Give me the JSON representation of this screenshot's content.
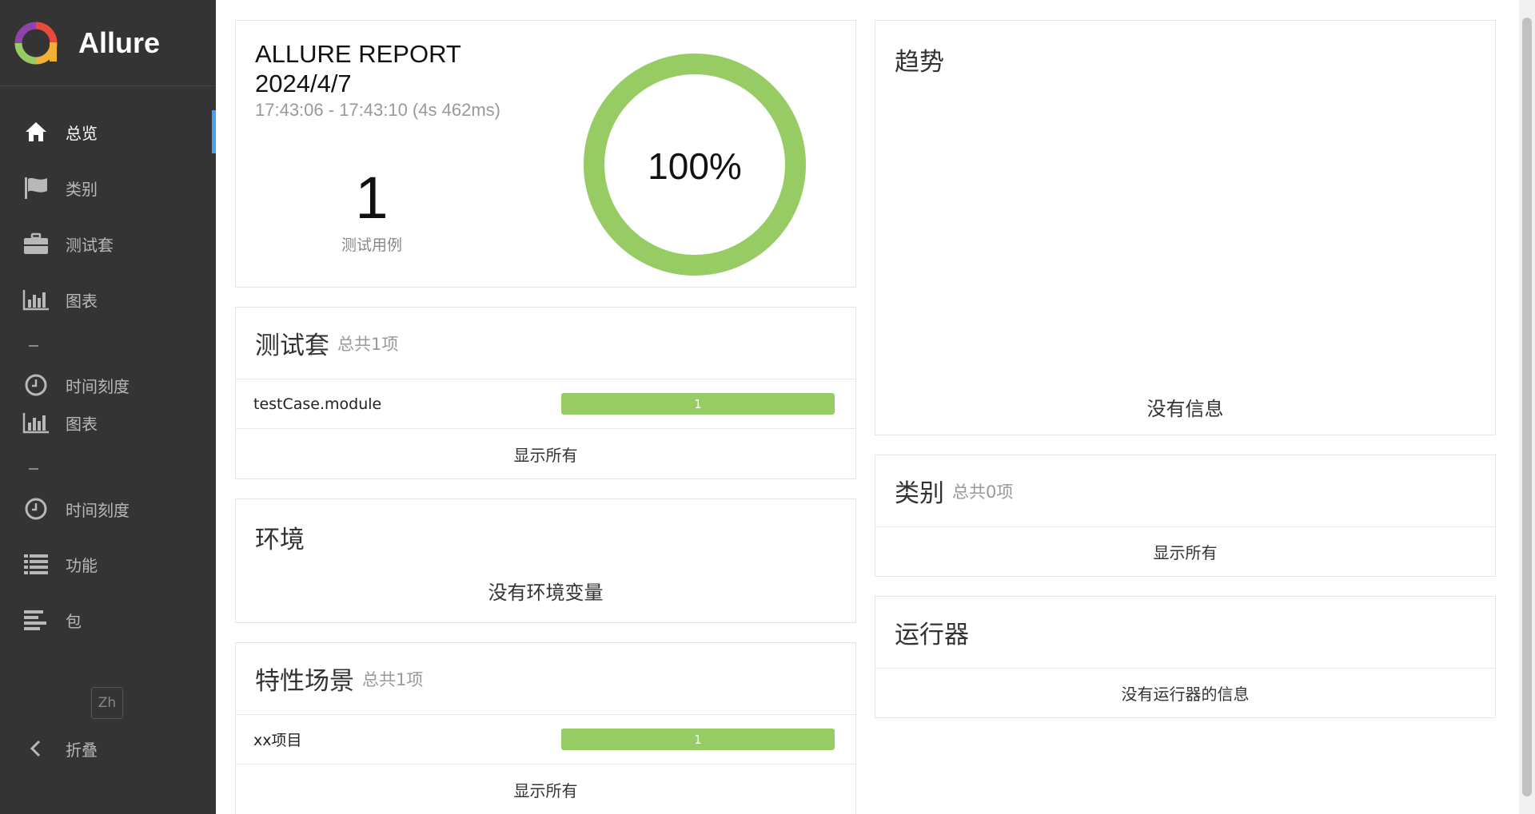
{
  "app": {
    "title": "Allure"
  },
  "sidebar": {
    "items": [
      {
        "label": "总览",
        "icon": "home-icon"
      },
      {
        "label": "类别",
        "icon": "flag-icon"
      },
      {
        "label": "测试套",
        "icon": "briefcase-icon"
      },
      {
        "label": "图表",
        "icon": "bar-chart-icon"
      },
      {
        "label": "时间刻度",
        "icon": "clock-icon"
      },
      {
        "label": "图表",
        "icon": "bar-chart-icon"
      },
      {
        "label": "时间刻度",
        "icon": "clock-icon"
      },
      {
        "label": "功能",
        "icon": "list-icon"
      },
      {
        "label": "包",
        "icon": "align-left-icon"
      }
    ],
    "lang": "Zh",
    "collapse": "折叠"
  },
  "summary": {
    "title": "ALLURE REPORT",
    "date": "2024/4/7",
    "time_range": "17:43:06 - 17:43:10 (4s 462ms)",
    "test_count": "1",
    "test_count_label": "测试用例",
    "pass_percent_label": "100%",
    "pass_fraction": 1.0,
    "ring_color": "#97cc64"
  },
  "suites": {
    "title": "测试套",
    "subtitle": "总共1项",
    "rows": [
      {
        "name": "testCase.module",
        "count": "1"
      }
    ],
    "show_all": "显示所有"
  },
  "environment": {
    "title": "环境",
    "empty": "没有环境变量"
  },
  "features": {
    "title": "特性场景",
    "subtitle": "总共1项",
    "rows": [
      {
        "name": "xx项目",
        "count": "1"
      }
    ],
    "show_all": "显示所有"
  },
  "trend": {
    "title": "趋势",
    "empty": "没有信息"
  },
  "categories": {
    "title": "类别",
    "subtitle": "总共0项",
    "show_all": "显示所有"
  },
  "executors": {
    "title": "运行器",
    "empty": "没有运行器的信息"
  }
}
